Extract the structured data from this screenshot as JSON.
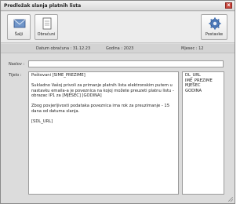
{
  "window": {
    "title": "Predložak slanja platnih lista",
    "close_label": "x"
  },
  "toolbar": {
    "send": {
      "label": "Šalji",
      "icon": "envelope-icon"
    },
    "calc": {
      "label": "Obračuni",
      "icon": "document-icon"
    },
    "settings": {
      "label": "Postavke",
      "icon": "gear-icon"
    }
  },
  "info": {
    "date": "Datum obračuna : 31.12.23",
    "year": "Godina : 2023",
    "month": "Mjesec : 12"
  },
  "form": {
    "subject_label": "Naslov :",
    "subject_value": "",
    "body_label": "Tijelo :",
    "body_paragraphs": [
      "Poštovani [SIME_PREZIME]",
      "Sukladno Vašoj privoli za primanje platnih lista elektronskim putem u nastavku emaila-a je poveznica na kojoj možete preuzeti platnu listu - obrazac IP1 za [MJESEC] [GODINA]",
      "Zbog povjerljivosti podataka poveznica ima rok za preuzimanje - 15 dana od datuma slanja.",
      "[SDL_URL]"
    ]
  },
  "variables": [
    "DL_URL",
    "IME_PREZIME",
    "MJESEC",
    "GODINA"
  ],
  "colors": {
    "window_bg": "#dcdcdc",
    "toolbar_bg": "#ececec",
    "info_bg": "#d3d3d3",
    "close_red": "#c8463d"
  }
}
